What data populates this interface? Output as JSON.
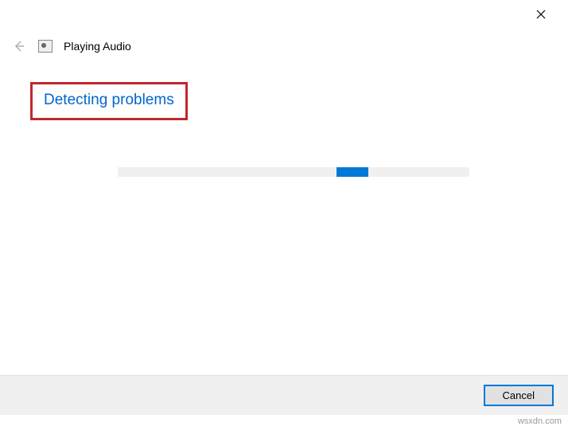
{
  "window": {
    "title": "Playing Audio"
  },
  "content": {
    "status_heading": "Detecting problems"
  },
  "progress": {
    "indeterminate": true,
    "segment_position_percent": 62,
    "segment_width_percent": 9
  },
  "footer": {
    "cancel_label": "Cancel"
  },
  "watermark": "wsxdn.com",
  "colors": {
    "accent": "#0078d7",
    "heading_text": "#0066cc",
    "highlight_border": "#c1272d"
  }
}
